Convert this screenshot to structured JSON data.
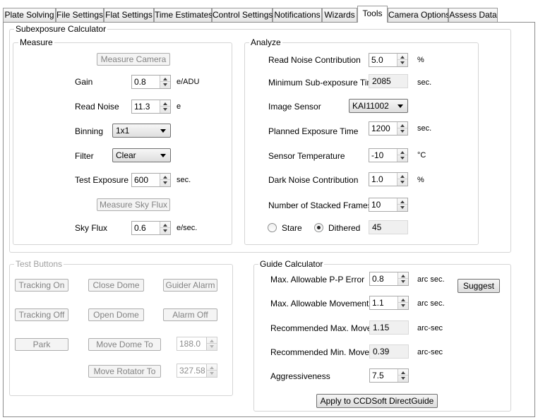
{
  "tabs": [
    "Plate Solving",
    "File Settings",
    "Flat Settings",
    "Time Estimates",
    "Control Settings",
    "Notifications",
    "Wizards",
    "Tools",
    "Camera Options",
    "Assess Data"
  ],
  "subexposure": {
    "title": "Subexposure Calculator",
    "measure": {
      "title": "Measure",
      "measure_camera_btn": "Measure Camera",
      "gain_label": "Gain",
      "gain_value": "0.8",
      "gain_unit": "e/ADU",
      "read_noise_label": "Read Noise",
      "read_noise_value": "11.3",
      "read_noise_unit": "e",
      "binning_label": "Binning",
      "binning_value": "1x1",
      "filter_label": "Filter",
      "filter_value": "Clear",
      "test_exposure_label": "Test Exposure",
      "test_exposure_value": "600",
      "test_exposure_unit": "sec.",
      "measure_sky_btn": "Measure Sky Flux",
      "sky_flux_label": "Sky Flux",
      "sky_flux_value": "0.6",
      "sky_flux_unit": "e/sec."
    },
    "analyze": {
      "title": "Analyze",
      "rnc_label": "Read Noise Contribution",
      "rnc_value": "5.0",
      "rnc_unit": "%",
      "mst_label": "Minimum Sub-exposure Time",
      "mst_value": "2085",
      "mst_unit": "sec.",
      "sensor_label": "Image Sensor",
      "sensor_value": "KAI11002",
      "pet_label": "Planned Exposure Time",
      "pet_value": "1200",
      "pet_unit": "sec.",
      "temp_label": "Sensor Temperature",
      "temp_value": "-10",
      "temp_unit": "°C",
      "dnc_label": "Dark Noise Contribution",
      "dnc_value": "1.0",
      "dnc_unit": "%",
      "frames_label": "Number of Stacked Frames",
      "frames_value": "10",
      "stare_label": "Stare",
      "dithered_label": "Dithered",
      "result_value": "45"
    }
  },
  "test_buttons": {
    "title": "Test Buttons",
    "tracking_on": "Tracking On",
    "close_dome": "Close Dome",
    "guider_alarm": "Guider Alarm",
    "tracking_off": "Tracking Off",
    "open_dome": "Open Dome",
    "alarm_off": "Alarm Off",
    "park": "Park",
    "move_dome_to": "Move Dome To",
    "dome_value": "188.0",
    "move_rotator_to": "Move Rotator To",
    "rotator_value": "327.58"
  },
  "guide": {
    "title": "Guide Calculator",
    "pp_label": "Max. Allowable P-P Error",
    "pp_value": "0.8",
    "pp_unit": "arc sec.",
    "suggest_btn": "Suggest",
    "move_label": "Max. Allowable Movement",
    "move_value": "1.1",
    "move_unit": "arc sec.",
    "rec_max_label": "Recommended Max. Move",
    "rec_max_value": "1.15",
    "rec_max_unit": "arc-sec",
    "rec_min_label": "Recommended Min. Move",
    "rec_min_value": "0.39",
    "rec_min_unit": "arc-sec",
    "aggr_label": "Aggressiveness",
    "aggr_value": "7.5",
    "apply_btn": "Apply to CCDSoft DirectGuide"
  }
}
